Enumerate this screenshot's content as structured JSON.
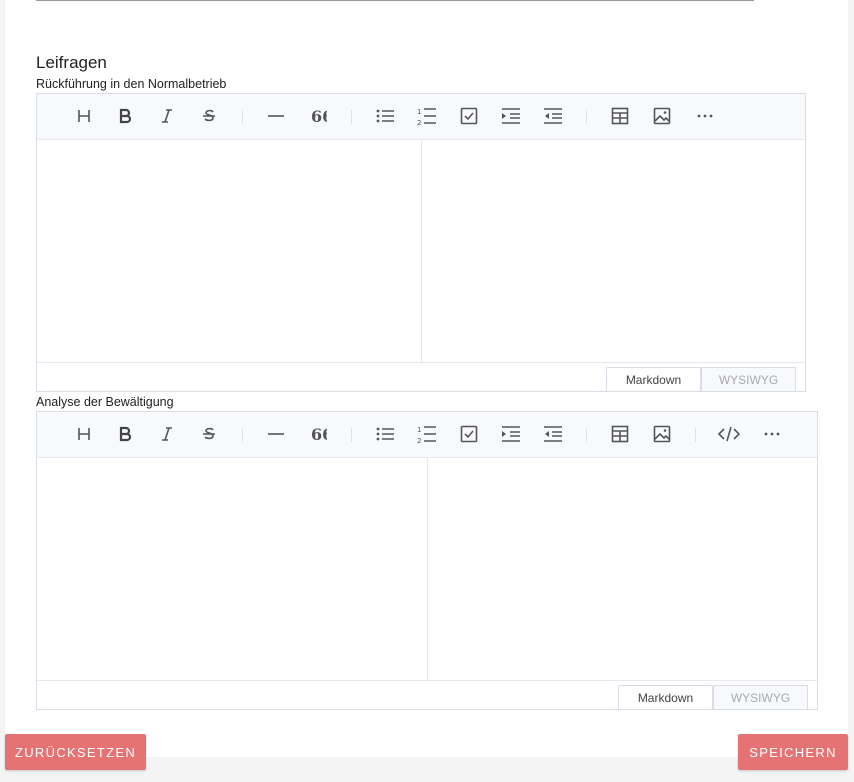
{
  "section": {
    "title": "Leifragen"
  },
  "editor1": {
    "label": "Rückführung in den Normalbetrieb",
    "mode_markdown": "Markdown",
    "mode_wysiwyg": "WYSIWYG"
  },
  "editor2": {
    "label": "Analyse der Bewältigung",
    "mode_markdown": "Markdown",
    "mode_wysiwyg": "WYSIWYG"
  },
  "toolbar_icons": [
    "heading-icon",
    "bold-icon",
    "italic-icon",
    "strike-icon",
    "hr-icon",
    "quote-icon",
    "bullet-list-icon",
    "ordered-list-icon",
    "task-list-icon",
    "indent-icon",
    "outdent-icon",
    "table-icon",
    "image-icon",
    "code-block-icon",
    "more-icon"
  ],
  "actions": {
    "reset_label": "ZURÜCKSETZEN",
    "save_label": "SPEICHERN"
  },
  "colors": {
    "accent": "#e57373",
    "toolbar_bg": "#f7f9fc",
    "icon": "#555555"
  }
}
